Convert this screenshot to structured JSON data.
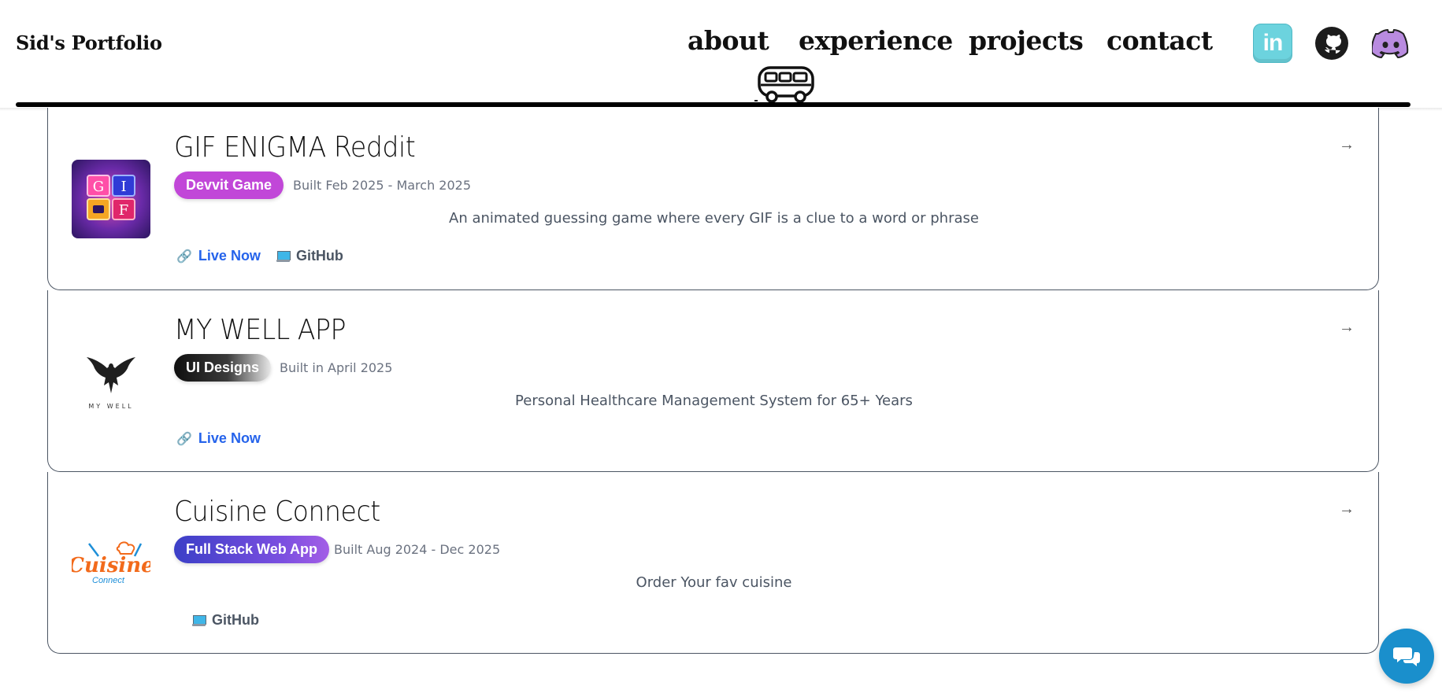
{
  "header": {
    "brand": "Sid's Portfolio",
    "nav": [
      "about",
      "experience",
      "projects",
      "contact"
    ],
    "social": {
      "linkedin_text": "in",
      "linkedin_color": "#6cd3de",
      "github_icon": "github-icon",
      "discord_color": "#b98be0"
    }
  },
  "projects": [
    {
      "title": "GIF ENIGMA Reddit",
      "badge": "Devvit Game",
      "badge_color": "#c147d8",
      "built": "Built Feb 2025 - March 2025",
      "description": "An animated guessing game where every GIF is a clue to a word or phrase",
      "links": {
        "live": "Live Now",
        "github": "GitHub"
      },
      "thumb_letters": [
        "G",
        "I",
        "F"
      ]
    },
    {
      "title": "MY WELL APP",
      "badge": "UI Designs",
      "badge_color": "#111111",
      "built": "Built in April 2025",
      "description": "Personal Healthcare Management System for 65+ Years",
      "links": {
        "live": "Live Now"
      },
      "thumb_caption": "MY WELL"
    },
    {
      "title": "Cuisine Connect",
      "badge": "Full Stack Web App",
      "badge_color": "#3b3fc7",
      "built": "Built Aug 2024 - Dec 2025",
      "description": "Order Your fav cuisine",
      "links": {
        "github": "GitHub"
      },
      "thumb_word": "Cuisine",
      "thumb_sub": "Connect"
    }
  ],
  "arrow": "→",
  "chat_icon": "chat-bubbles-icon"
}
